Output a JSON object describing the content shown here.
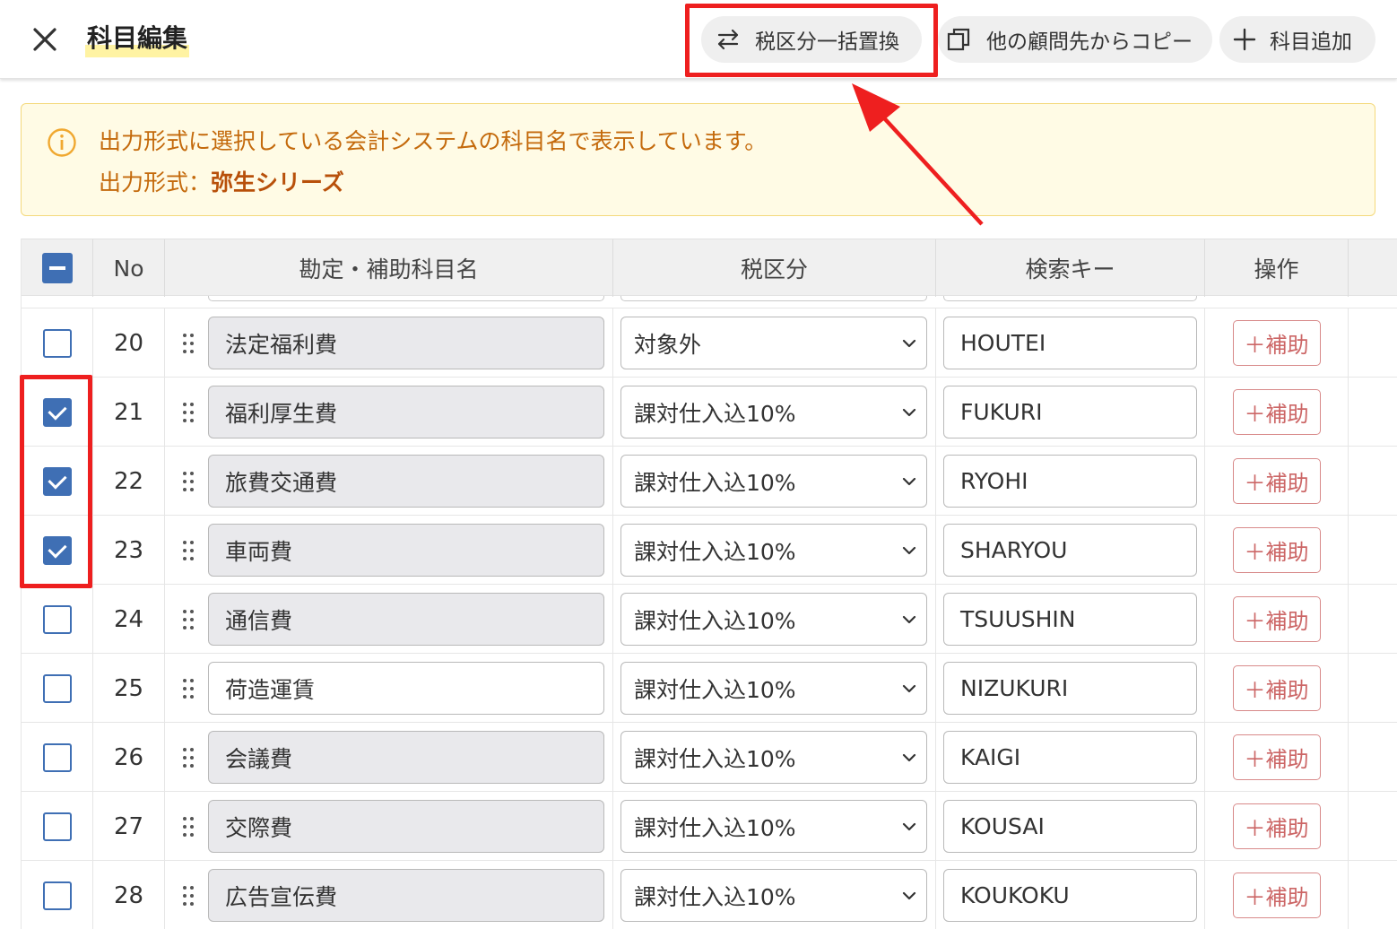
{
  "header": {
    "title": "科目編集",
    "tax_replace_label": "税区分一括置換",
    "copy_label": "他の顧問先からコピー",
    "add_label": "科目追加"
  },
  "notice": {
    "line1": "出力形式に選択している会計システムの科目名で表示しています。",
    "line2_prefix": "出力形式：",
    "line2_value": "弥生シリーズ"
  },
  "table": {
    "columns": [
      "No",
      "勘定・補助科目名",
      "税区分",
      "検索キー",
      "操作"
    ],
    "sub_button_label": "＋補助",
    "rows": [
      {
        "no": "20",
        "name": "法定福利費",
        "tax": "対象外",
        "key": "HOUTEI",
        "checked": false,
        "editable": false
      },
      {
        "no": "21",
        "name": "福利厚生費",
        "tax": "課対仕入込10%",
        "key": "FUKURI",
        "checked": true,
        "editable": false
      },
      {
        "no": "22",
        "name": "旅費交通費",
        "tax": "課対仕入込10%",
        "key": "RYOHI",
        "checked": true,
        "editable": false
      },
      {
        "no": "23",
        "name": "車両費",
        "tax": "課対仕入込10%",
        "key": "SHARYOU",
        "checked": true,
        "editable": false
      },
      {
        "no": "24",
        "name": "通信費",
        "tax": "課対仕入込10%",
        "key": "TSUUSHIN",
        "checked": false,
        "editable": false
      },
      {
        "no": "25",
        "name": "荷造運賃",
        "tax": "課対仕入込10%",
        "key": "NIZUKURI",
        "checked": false,
        "editable": true
      },
      {
        "no": "26",
        "name": "会議費",
        "tax": "課対仕入込10%",
        "key": "KAIGI",
        "checked": false,
        "editable": false
      },
      {
        "no": "27",
        "name": "交際費",
        "tax": "課対仕入込10%",
        "key": "KOUSAI",
        "checked": false,
        "editable": false
      },
      {
        "no": "28",
        "name": "広告宣伝費",
        "tax": "課対仕入込10%",
        "key": "KOUKOKU",
        "checked": false,
        "editable": false
      }
    ]
  },
  "colors": {
    "accent": "#3f6fb4",
    "annotation_red": "#ee1f1f",
    "notice_text": "#c46a0c",
    "sub_button": "#cc6666"
  }
}
